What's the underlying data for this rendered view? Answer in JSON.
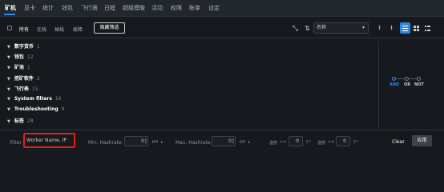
{
  "nav": {
    "items": [
      "矿机",
      "显卡",
      "统计",
      "钱包",
      "飞行表",
      "日程",
      "超级模版",
      "活动",
      "权限",
      "账单",
      "设定"
    ],
    "active": "矿机",
    "accent": "#2b8ae8"
  },
  "toolbar": {
    "filters": [
      "所有",
      "在线",
      "掉线",
      "故障"
    ],
    "active_filter": "所有",
    "hide_filter_label": "隐藏筛选",
    "sort_value": "名称",
    "icons": [
      "collapse-icon",
      "sort-icon",
      "chevron-down-icon",
      "upload-icon",
      "download-icon",
      "list-view-icon",
      "grid-view-icon",
      "compact-view-icon"
    ]
  },
  "groups": [
    {
      "label": "数字货币",
      "count": "1"
    },
    {
      "label": "钱包",
      "count": "12"
    },
    {
      "label": "矿池",
      "count": "1"
    },
    {
      "label": "挖矿软件",
      "count": "2"
    },
    {
      "label": "飞行表",
      "count": "15"
    },
    {
      "label": "System filters",
      "count": "16"
    },
    {
      "label": "Troubleshooting",
      "count": "9"
    },
    {
      "label": "标签",
      "count": "28"
    }
  ],
  "logic": {
    "options": [
      "AND",
      "OR",
      "NOT"
    ],
    "active": "AND"
  },
  "bottom": {
    "filter_label": "Filter",
    "worker_placeholder": "Worker Name, IP",
    "min_hashrate_label": "Min. Hashrate",
    "min_hashrate_value": "0",
    "min_unit": "KH",
    "max_hashrate_label": "Max. Hashrate",
    "max_hashrate_value": "0",
    "max_unit": "KH",
    "temp1_label": "温度",
    "temp1_op": ">=",
    "temp1_value": "0",
    "temp2_label": "温度",
    "temp2_op": "<=",
    "temp2_value": "0",
    "temp_unit": "C°",
    "clear_label": "Clear",
    "apply_label": "应用"
  }
}
